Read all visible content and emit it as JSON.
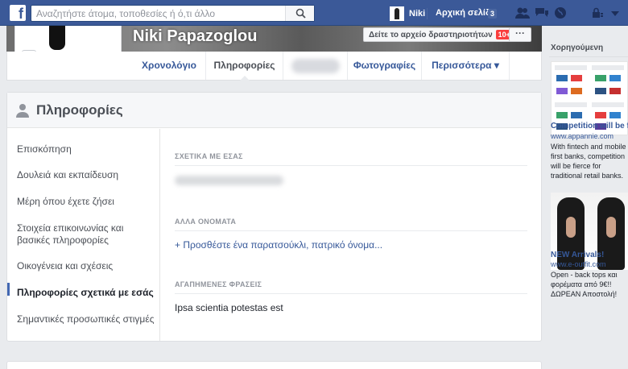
{
  "topbar": {
    "logo": "f",
    "search_placeholder": "Αναζητήστε άτομα, τοποθεσίες ή ό,τι άλλο",
    "user_name": "Niki",
    "home_label": "Αρχική σελίδα",
    "home_count": "3"
  },
  "profile": {
    "name": "Niki Papazoglou",
    "activity_button": "Δείτε το αρχείο δραστηριοτήτων",
    "activity_badge": "10+",
    "more_button": "···"
  },
  "tabs": [
    {
      "label": "Χρονολόγιο"
    },
    {
      "label": "Πληροφορίες"
    },
    {
      "label": "Φωτογραφίες"
    },
    {
      "label": "Περισσότερα ▾"
    }
  ],
  "about": {
    "title": "Πληροφορίες",
    "menu": [
      "Επισκόπηση",
      "Δουλειά και εκπαίδευση",
      "Μέρη όπου έχετε ζήσει",
      "Στοιχεία επικοινωνίας και βασικές πληροφορίες",
      "Οικογένεια και σχέσεις",
      "Πληροφορίες σχετικά με εσάς",
      "Σημαντικές προσωπικές στιγμές"
    ],
    "sections": {
      "about_you_title": "ΣΧΕΤΙΚΑ ΜΕ ΕΣΑΣ",
      "other_names_title": "ΑΛΛΑ ΟΝΟΜΑΤΑ",
      "add_nickname": "+ Προσθέστε ένα παρατσούκλι, πατρικό όνομα...",
      "quotes_title": "ΑΓΑΠΗΜΕΝΕΣ ΦΡΑΣΕΙΣ",
      "quote": "Ipsa scientia potestas est"
    }
  },
  "sponsored": {
    "label": "Χορηγούμενη",
    "ad1": {
      "title": "Competition will be fierce",
      "url": "www.appannie.com",
      "body": "With fintech and mobile first banks, competition will be fierce for traditional retail banks."
    },
    "ad2": {
      "title": "NEW Arrivals!",
      "url": "www.e-outfit.com",
      "body": "Open - back tops και φορέματα από 9€!! ΔΩΡΕΑΝ Αποστολή!"
    }
  },
  "colors": {
    "brand": "#3b5998",
    "link": "#365899",
    "badge": "#fa3e3e"
  }
}
